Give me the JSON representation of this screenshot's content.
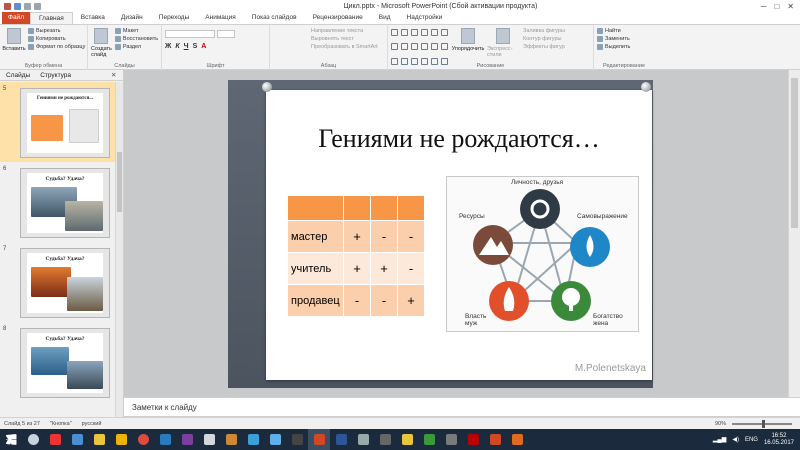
{
  "window": {
    "title": "Цикл.pptx - Microsoft PowerPoint (Сбой активации продукта)",
    "min": "─",
    "max": "□",
    "close": "✕"
  },
  "tabs": [
    "Файл",
    "Главная",
    "Вставка",
    "Дизайн",
    "Переходы",
    "Анимация",
    "Показ слайдов",
    "Рецензирование",
    "Вид",
    "Надстройки"
  ],
  "ribbon": {
    "clipboard": {
      "label": "Буфер обмена",
      "paste": "Вставить",
      "cut": "Вырезать",
      "copy": "Копировать",
      "format": "Формат по образцу"
    },
    "slides": {
      "label": "Слайды",
      "new": "Создать слайд",
      "layout": "Макет",
      "reset": "Восстановить",
      "section": "Раздел"
    },
    "font": {
      "label": "Шрифт"
    },
    "paragraph": {
      "label": "Абзац",
      "dir": "Направление текста",
      "align": "Выровнять текст",
      "smartart": "Преобразовать в SmartArt"
    },
    "drawing": {
      "label": "Рисование",
      "arrange": "Упорядочить",
      "styles": "Экспресс-стили",
      "fill": "Заливка фигуры",
      "outline": "Контур фигуры",
      "effects": "Эффекты фигур"
    },
    "editing": {
      "label": "Редактирование",
      "find": "Найти",
      "replace": "Заменить",
      "select": "Выделить"
    }
  },
  "left_panel": {
    "tab_slides": "Слайды",
    "tab_outline": "Структура",
    "close": "✕",
    "thumbs": [
      {
        "num": "5",
        "title": "Гениями не рождаются..."
      },
      {
        "num": "6",
        "title": "Судьба? Удача?"
      },
      {
        "num": "7",
        "title": "Судьба? Удача?"
      },
      {
        "num": "8",
        "title": "Судьба? Удача?"
      }
    ]
  },
  "slide": {
    "title": "Гениями не рождаются…",
    "table": [
      {
        "name": "мастер",
        "c1": "+",
        "c2": "-",
        "c3": "-"
      },
      {
        "name": "учитель",
        "c1": "+",
        "c2": "+",
        "c3": "-"
      },
      {
        "name": "продавец",
        "c1": "-",
        "c2": "-",
        "c3": "+"
      }
    ],
    "diagram": {
      "top": "Личность, друзья",
      "left": "Ресурсы",
      "right": "Самовыражение",
      "bottom_left": "Власть\nмуж",
      "bottom_right": "Богатство\nжена"
    },
    "watermark": "M.Polenetskaya"
  },
  "notes": {
    "placeholder": "Заметки к слайду"
  },
  "status": {
    "slide": "Слайд 5 из 27",
    "theme": "\"Кнопка\"",
    "lang": "русский",
    "zoom": "90%"
  },
  "taskbar": {
    "lang": "ENG",
    "time": "16:52",
    "date": "16.05.2017"
  }
}
